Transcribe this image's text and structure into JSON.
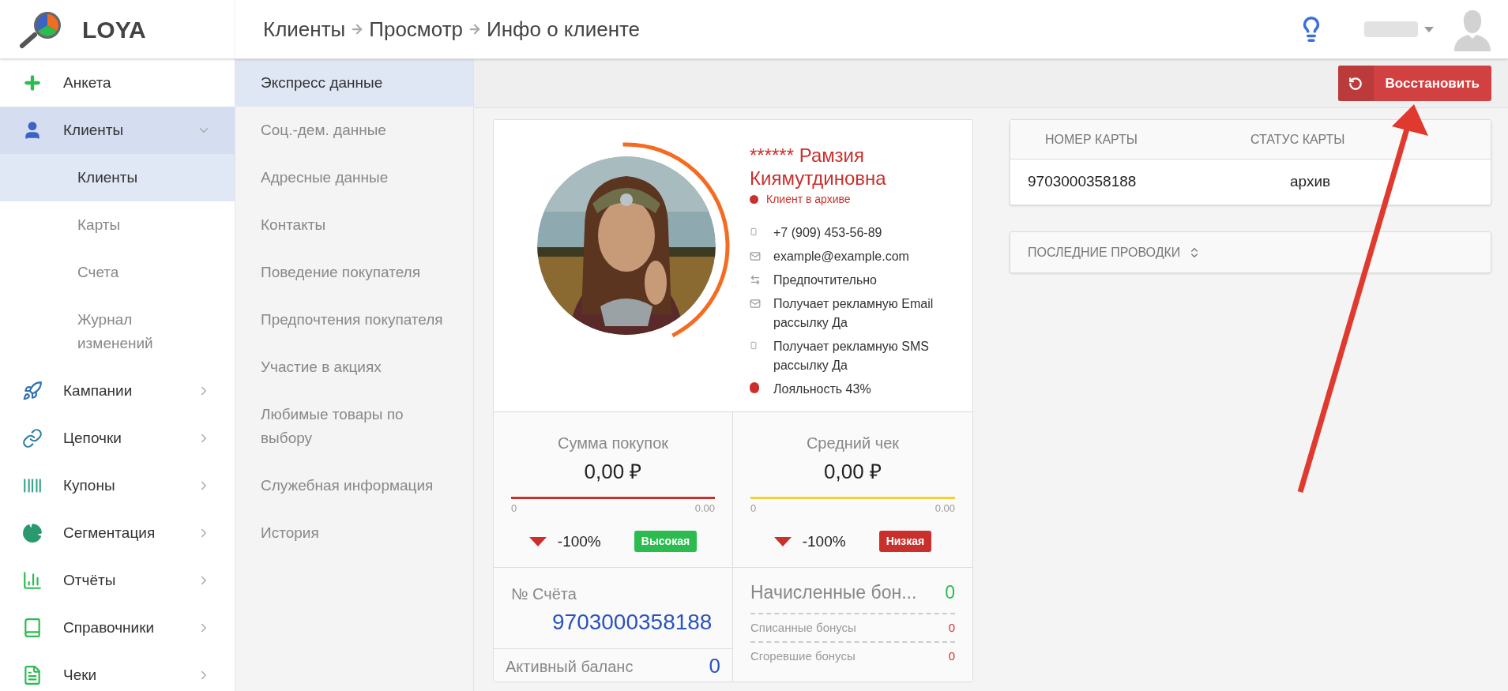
{
  "logo": {
    "text": "LOYA"
  },
  "breadcrumb": [
    "Клиенты",
    "Просмотр",
    "Инфо о клиенте"
  ],
  "sidebar": {
    "items": [
      {
        "label": "Анкета",
        "selected": false
      },
      {
        "label": "Клиенты",
        "selected": true,
        "expanded": true,
        "children": [
          {
            "label": "Клиенты",
            "selected": true
          },
          {
            "label": "Карты",
            "selected": false
          },
          {
            "label": "Счета",
            "selected": false
          },
          {
            "label": "Журнал изменений",
            "selected": false
          }
        ]
      },
      {
        "label": "Кампании",
        "selected": false,
        "expanded": false
      },
      {
        "label": "Цепочки",
        "selected": false,
        "expanded": false
      },
      {
        "label": "Купоны",
        "selected": false,
        "expanded": false
      },
      {
        "label": "Сегментация",
        "selected": false,
        "expanded": false
      },
      {
        "label": "Отчёты",
        "selected": false,
        "expanded": false
      },
      {
        "label": "Справочники",
        "selected": false,
        "expanded": false
      },
      {
        "label": "Чеки",
        "selected": false,
        "expanded": false
      }
    ]
  },
  "sections": [
    {
      "label": "Экспресс данные",
      "selected": true
    },
    {
      "label": "Соц.-дем. данные",
      "selected": false
    },
    {
      "label": "Адресные данные",
      "selected": false
    },
    {
      "label": "Контакты",
      "selected": false
    },
    {
      "label": "Поведение покупателя",
      "selected": false
    },
    {
      "label": "Предпочтения покупателя",
      "selected": false
    },
    {
      "label": "Участие в акциях",
      "selected": false
    },
    {
      "label": "Любимые товары по выбору",
      "selected": false
    },
    {
      "label": "Служебная информация",
      "selected": false
    },
    {
      "label": "История",
      "selected": false
    }
  ],
  "toolbar": {
    "restore_button": "Восстановить"
  },
  "profile": {
    "name": "****** Рамзия Киямутдиновна",
    "status": "Клиент в архиве",
    "loyalty_ring": {
      "level": 0.43
    },
    "contacts": [
      {
        "kind": "phone",
        "text": "+7 (909) 453-56-89"
      },
      {
        "kind": "email",
        "text": "example@example.com"
      },
      {
        "kind": "exchange",
        "text": "Предпочтительно"
      },
      {
        "kind": "email",
        "text": "Получает рекламную Email рассылку Да"
      },
      {
        "kind": "phone",
        "text": "Получает рекламную SMS рассылку Да"
      },
      {
        "kind": "dot",
        "text": "Лояльность 43%"
      }
    ]
  },
  "stats": [
    {
      "title": "Сумма покупок",
      "value": "0,00 ₽",
      "color": "#c9302c",
      "min": "0",
      "max": "0.00",
      "change": "-100%",
      "badge": {
        "text": "Высокая",
        "color": "#2bbb4f"
      }
    },
    {
      "title": "Средний чек",
      "value": "0,00 ₽",
      "color": "#f5d130",
      "min": "0",
      "max": "0.00",
      "change": "-100%",
      "badge": {
        "text": "Низкая",
        "color": "#c9302c"
      }
    }
  ],
  "account": {
    "label": "№ Счёта",
    "number": "9703000358188"
  },
  "balance": {
    "label": "Активный баланс",
    "value": "0"
  },
  "bonuses": [
    {
      "kind": "total",
      "label": "Начисленные бон...",
      "value": "0",
      "color": "#2bbb4f"
    },
    {
      "kind": "detail",
      "label": "Списанные бонусы",
      "value": "0",
      "color": "#d0312d"
    },
    {
      "kind": "detail",
      "label": "Сгоревшие бонусы",
      "value": "0",
      "color": "#d0312d"
    }
  ],
  "cards_table": {
    "columns": [
      "НОМЕР КАРТЫ",
      "СТАТУС КАРТЫ"
    ],
    "rows": [
      [
        "9703000358188",
        "архив"
      ]
    ]
  },
  "transactions": {
    "title": "ПОСЛЕДНИЕ ПРОВОДКИ"
  }
}
